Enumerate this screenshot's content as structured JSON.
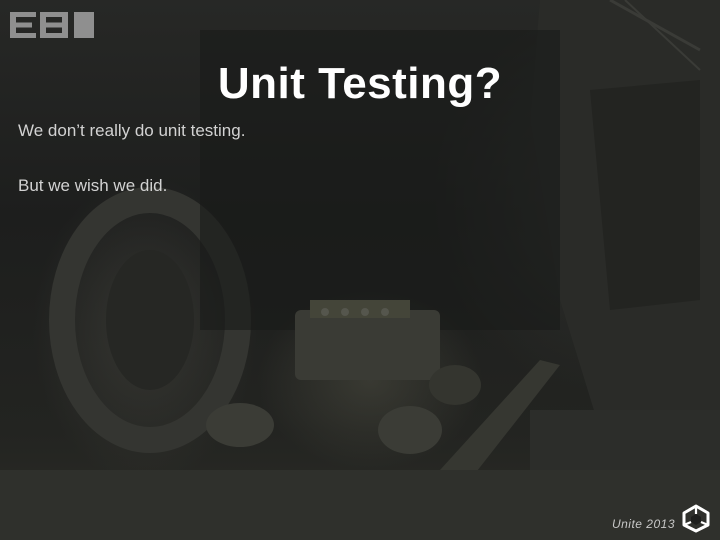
{
  "slide": {
    "logo_text": "BBI",
    "title": "Unit Testing?",
    "lines": [
      "We don’t really do unit testing.",
      "But we wish we did."
    ],
    "footer": "Unite 2013",
    "icons": {
      "logo": "bbi-logo",
      "footer": "unity-logo-icon"
    },
    "colors": {
      "background": "#1b1c1b",
      "title": "#ffffff",
      "body_text": "#d2d2d2"
    }
  }
}
